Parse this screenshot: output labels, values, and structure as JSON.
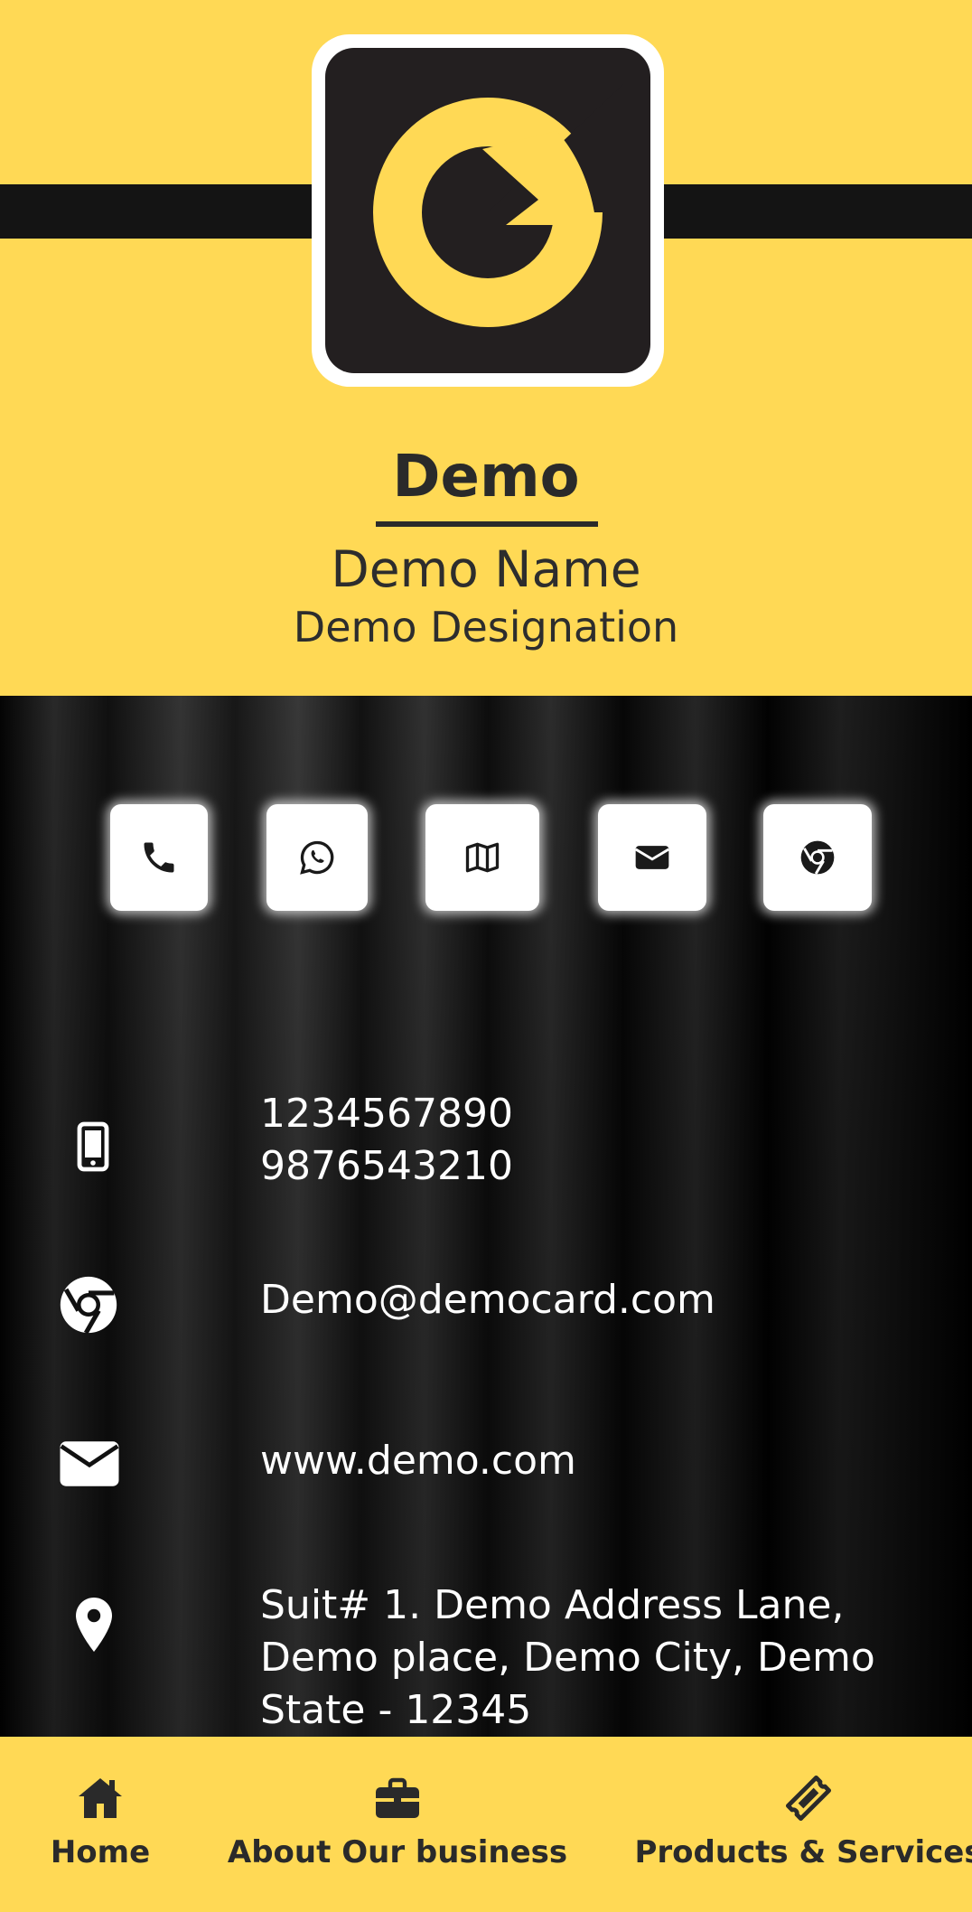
{
  "colors": {
    "accent": "#ffd955",
    "dark": "#141414",
    "text_dark": "#2a2a2a",
    "text_light": "#ffffff"
  },
  "header": {
    "company": "Demo",
    "name": "Demo Name",
    "designation": "Demo Designation",
    "logo_icon": "g-logo"
  },
  "actions": [
    {
      "icon": "phone-icon"
    },
    {
      "icon": "whatsapp-icon"
    },
    {
      "icon": "map-icon"
    },
    {
      "icon": "envelope-icon"
    },
    {
      "icon": "chrome-icon"
    }
  ],
  "contact": {
    "phone1": "1234567890",
    "phone2": "9876543210",
    "email": "Demo@democard.com",
    "website": "www.demo.com",
    "address_line1": "Suit# 1. Demo Address Lane,",
    "address_line2": "Demo place, Demo City, Demo",
    "address_line3": "State - 12345"
  },
  "nav": {
    "home": "Home",
    "about": "About Our business",
    "products": "Products & Services"
  }
}
